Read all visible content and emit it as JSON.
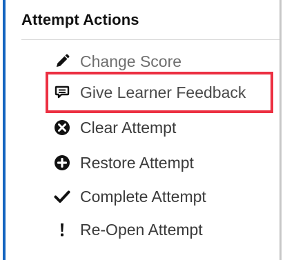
{
  "panel": {
    "title": "Attempt Actions",
    "accent_color": "#1565c0",
    "highlight_color": "#ec3042"
  },
  "actions": [
    {
      "label": "Change Score",
      "icon": "pencil-icon"
    },
    {
      "label": "Give Learner Feedback",
      "icon": "comment-icon"
    },
    {
      "label": "Clear Attempt",
      "icon": "times-circle-icon"
    },
    {
      "label": "Restore Attempt",
      "icon": "plus-circle-icon"
    },
    {
      "label": "Complete Attempt",
      "icon": "checkmark-icon"
    },
    {
      "label": "Re-Open Attempt",
      "icon": "exclamation-icon"
    }
  ]
}
